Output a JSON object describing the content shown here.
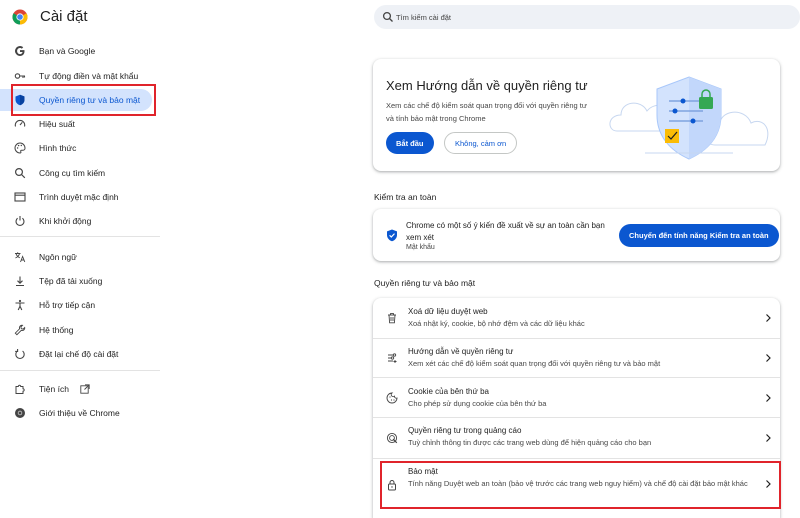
{
  "header": {
    "app_title": "Cài đặt",
    "search_placeholder": "Tìm kiếm cài đặt"
  },
  "sidebar": {
    "items": [
      {
        "label": "Bạn và Google",
        "icon": "google-g-icon"
      },
      {
        "label": "Tự động điền và mật khẩu",
        "icon": "key-icon"
      },
      {
        "label": "Quyền riêng tư và bảo mật",
        "icon": "shield-icon",
        "active": true
      },
      {
        "label": "Hiệu suất",
        "icon": "speedometer-icon"
      },
      {
        "label": "Hình thức",
        "icon": "palette-icon"
      },
      {
        "label": "Công cụ tìm kiếm",
        "icon": "search-icon"
      },
      {
        "label": "Trình duyệt mặc định",
        "icon": "browser-window-icon"
      },
      {
        "label": "Khi khởi động",
        "icon": "power-icon"
      },
      {
        "label": "Ngôn ngữ",
        "icon": "translate-icon"
      },
      {
        "label": "Tệp đã tải xuống",
        "icon": "download-icon"
      },
      {
        "label": "Hỗ trợ tiếp cận",
        "icon": "accessibility-icon"
      },
      {
        "label": "Hệ thống",
        "icon": "wrench-icon"
      },
      {
        "label": "Đặt lại chế độ cài đặt",
        "icon": "reset-icon"
      },
      {
        "label": "Tiện ích",
        "icon": "puzzle-icon"
      },
      {
        "label": "Giới thiệu về Chrome",
        "icon": "chrome-icon"
      }
    ]
  },
  "guide_card": {
    "title": "Xem Hướng dẫn về quyền riêng tư",
    "description": "Xem các chế độ kiểm soát quan trọng đối với quyền riêng tư và tính bảo mật trong Chrome",
    "start_label": "Bắt đầu",
    "dismiss_label": "Không, cảm ơn"
  },
  "safety_check": {
    "heading": "Kiểm tra an toàn",
    "message": "Chrome có một số ý kiến đề xuất về sự an toàn cần bạn xem xét",
    "sub": "Mật khẩu",
    "button_label": "Chuyển đến tính năng Kiểm tra an toàn"
  },
  "privacy_section": {
    "heading": "Quyền riêng tư và bảo mật",
    "rows": [
      {
        "title": "Xoá dữ liệu duyệt web",
        "sub": "Xoá nhật ký, cookie, bộ nhớ đệm và các dữ liệu khác",
        "icon": "trash-icon"
      },
      {
        "title": "Hướng dẫn về quyền riêng tư",
        "sub": "Xem xét các chế độ kiểm soát quan trọng đối với quyền riêng tư và bảo mật",
        "icon": "privacy-guide-icon"
      },
      {
        "title": "Cookie của bên thứ ba",
        "sub": "Cho phép sử dụng cookie của bên thứ ba",
        "icon": "cookie-icon"
      },
      {
        "title": "Quyền riêng tư trong quảng cáo",
        "sub": "Tuỳ chỉnh thông tin được các trang web dùng để hiện quảng cáo cho bạn",
        "icon": "ad-privacy-icon"
      },
      {
        "title": "Bảo mật",
        "sub": "Tính năng Duyệt web an toàn (bảo vệ trước các trang web nguy hiểm) và chế độ cài đặt bảo mật khác",
        "icon": "lock-icon"
      }
    ]
  },
  "colors": {
    "accent": "#0b57d0",
    "active_bg": "#d3e3fd",
    "highlight": "#e0242b"
  }
}
